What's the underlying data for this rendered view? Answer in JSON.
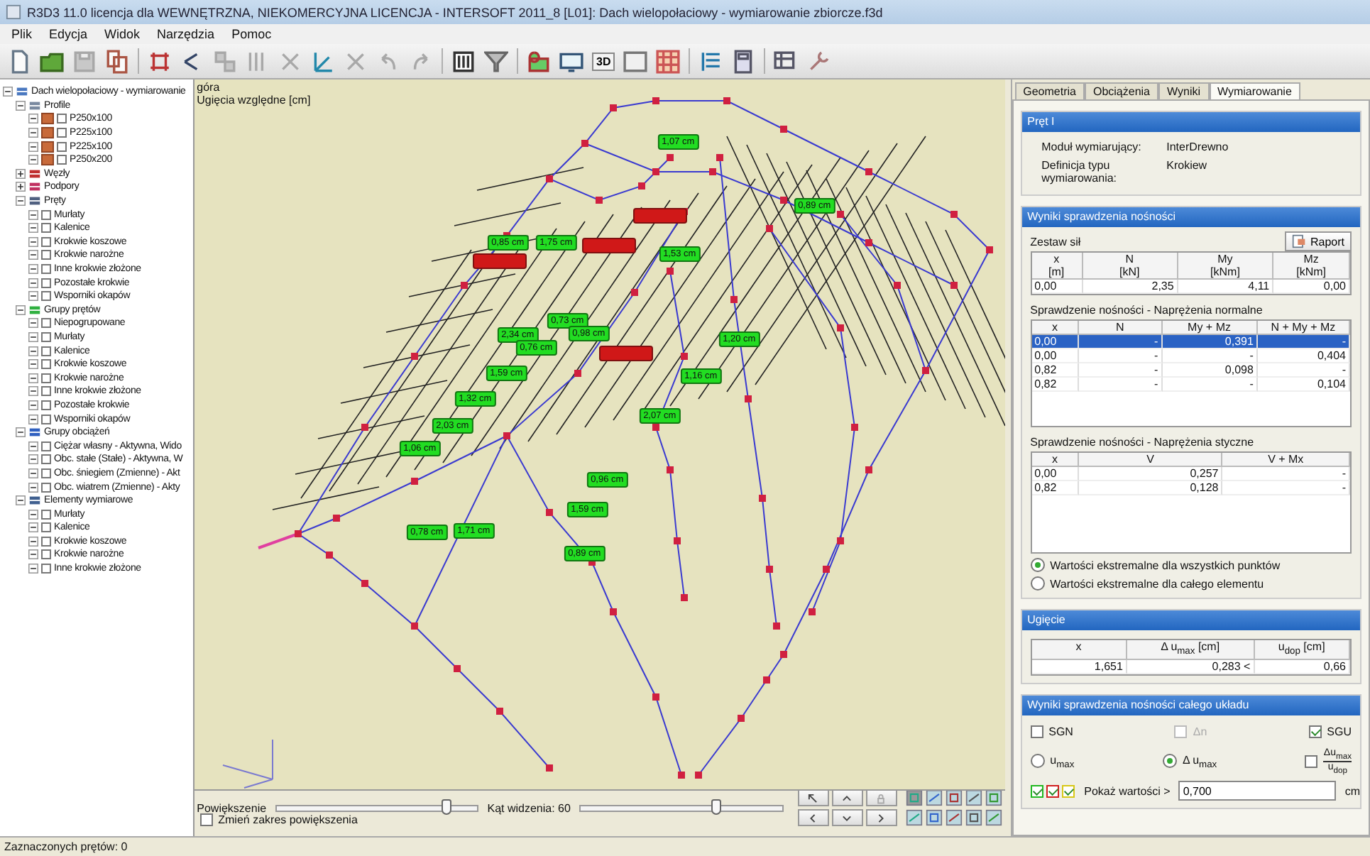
{
  "window": {
    "title": "R3D3 11.0 licencja dla WEWNĘTRZNA, NIEKOMERCYJNA LICENCJA - INTERSOFT 2011_8 [L01]: Dach wielopołaciowy - wymiarowanie zbiorcze.f3d"
  },
  "menu": [
    "Plik",
    "Edycja",
    "Widok",
    "Narzędzia",
    "Pomoc"
  ],
  "toolbar": [
    {
      "disabled": false
    },
    {
      "disabled": false
    },
    {
      "disabled": true
    },
    {
      "disabled": false
    },
    {
      "disabled": false
    },
    {
      "disabled": false
    },
    {
      "disabled": true
    },
    {
      "disabled": true
    },
    {
      "disabled": true
    },
    {
      "disabled": false
    },
    {
      "disabled": true
    },
    {
      "disabled": true
    },
    {
      "disabled": true
    },
    {
      "disabled": false
    },
    {
      "disabled": false
    },
    {
      "disabled": false
    },
    {
      "disabled": false
    },
    {
      "disabled": false,
      "text": "3D"
    },
    {
      "disabled": false
    },
    {
      "disabled": false
    },
    {
      "disabled": false
    },
    {
      "disabled": false
    },
    {
      "disabled": false
    },
    {
      "disabled": false
    }
  ],
  "tree": [
    {
      "label": "Dach wielopołaciowy - wymiarowanie",
      "kind": "group",
      "expanded": true,
      "children": [
        {
          "label": "Profile",
          "kind": "group",
          "expanded": true,
          "children": [
            {
              "label": "P250x100",
              "kind": "profile",
              "checked": false
            },
            {
              "label": "P225x100",
              "kind": "profile",
              "checked": false
            },
            {
              "label": "P225x100",
              "kind": "profile",
              "checked": false
            },
            {
              "label": "P250x200",
              "kind": "profile",
              "checked": false
            }
          ]
        },
        {
          "label": "Węzły",
          "kind": "group",
          "expanded": false
        },
        {
          "label": "Podpory",
          "kind": "group",
          "expanded": false
        },
        {
          "label": "Pręty",
          "kind": "group",
          "expanded": true,
          "children": [
            {
              "label": "Murłaty",
              "kind": "item",
              "checked": false
            },
            {
              "label": "Kalenice",
              "kind": "item",
              "checked": false
            },
            {
              "label": "Krokwie koszowe",
              "kind": "item",
              "checked": false
            },
            {
              "label": "Krokwie narożne",
              "kind": "item",
              "checked": false
            },
            {
              "label": "Inne krokwie złożone",
              "kind": "item",
              "checked": false
            },
            {
              "label": "Pozostałe krokwie",
              "kind": "item",
              "checked": false
            },
            {
              "label": "Wsporniki okapów",
              "kind": "item",
              "checked": false
            }
          ]
        },
        {
          "label": "Grupy prętów",
          "kind": "group",
          "expanded": true,
          "children": [
            {
              "label": "Niepogrupowane",
              "kind": "item",
              "checked": false
            },
            {
              "label": "Murłaty",
              "kind": "item",
              "checked": false
            },
            {
              "label": "Kalenice",
              "kind": "item",
              "checked": false
            },
            {
              "label": "Krokwie koszowe",
              "kind": "item",
              "checked": false
            },
            {
              "label": "Krokwie narożne",
              "kind": "item",
              "checked": false
            },
            {
              "label": "Inne krokwie złożone",
              "kind": "item",
              "checked": false
            },
            {
              "label": "Pozostałe krokwie",
              "kind": "item",
              "checked": false
            },
            {
              "label": "Wsporniki okapów",
              "kind": "item",
              "checked": false
            }
          ]
        },
        {
          "label": "Grupy obciążeń",
          "kind": "group",
          "expanded": true,
          "children": [
            {
              "label": "Ciężar własny - Aktywna, Wido",
              "kind": "item",
              "checked": false
            },
            {
              "label": "Obc. stałe (Stałe) - Aktywna, W",
              "kind": "item",
              "checked": false
            },
            {
              "label": "Obc. śniegiem (Zmienne) - Akt",
              "kind": "item",
              "checked": false
            },
            {
              "label": "Obc. wiatrem (Zmienne) - Akty",
              "kind": "item",
              "checked": false
            }
          ]
        },
        {
          "label": "Elementy wymiarowe",
          "kind": "group",
          "expanded": true,
          "children": [
            {
              "label": "Murłaty",
              "kind": "item",
              "checked": false
            },
            {
              "label": "Kalenice",
              "kind": "item",
              "checked": false
            },
            {
              "label": "Krokwie koszowe",
              "kind": "item",
              "checked": false
            },
            {
              "label": "Krokwie narożne",
              "kind": "item",
              "checked": false
            },
            {
              "label": "Inne krokwie złożone",
              "kind": "item",
              "checked": false
            }
          ]
        }
      ]
    }
  ],
  "canvas": {
    "view": "góra",
    "legend": "Ugięcia względne [cm]",
    "labels": [
      {
        "text": "1,07 cm",
        "exceeded": false
      },
      {
        "text": "0,89 cm",
        "exceeded": false
      },
      {
        "exceeded": true
      },
      {
        "text": "0,85 cm",
        "exceeded": false
      },
      {
        "text": "1,75 cm",
        "exceeded": false
      },
      {
        "exceeded": true
      },
      {
        "exceeded": true
      },
      {
        "text": "1,53 cm",
        "exceeded": false
      },
      {
        "text": "0,73 cm",
        "exceeded": false
      },
      {
        "text": "2,34 cm",
        "exceeded": false
      },
      {
        "text": "0,98 cm",
        "exceeded": false
      },
      {
        "text": "0,76 cm",
        "exceeded": false
      },
      {
        "exceeded": true
      },
      {
        "text": "1,20 cm",
        "exceeded": false
      },
      {
        "text": "1,59 cm",
        "exceeded": false
      },
      {
        "text": "1,16 cm",
        "exceeded": false
      },
      {
        "text": "1,32 cm",
        "exceeded": false
      },
      {
        "text": "2,07 cm",
        "exceeded": false
      },
      {
        "text": "2,03 cm",
        "exceeded": false
      },
      {
        "text": "1,06 cm",
        "exceeded": false
      },
      {
        "text": "0,96 cm",
        "exceeded": false
      },
      {
        "text": "1,59 cm",
        "exceeded": false
      },
      {
        "text": "0,78 cm",
        "exceeded": false
      },
      {
        "text": "1,71 cm",
        "exceeded": false
      },
      {
        "text": "0,89 cm",
        "exceeded": false
      }
    ]
  },
  "view_controls": {
    "zoom": {
      "label": "Powiększenie",
      "level": 0.85
    },
    "angle": {
      "label": "Kąt widzenia: 60",
      "level": 0.68
    },
    "zoom_range": {
      "label": "Zmień zakres powiększenia",
      "checked": false
    }
  },
  "right_panel": {
    "tabs": [
      {
        "label": "Geometria",
        "selected": false
      },
      {
        "label": "Obciążenia",
        "selected": false
      },
      {
        "label": "Wyniki",
        "selected": false
      },
      {
        "label": "Wymiarowanie",
        "selected": true
      }
    ],
    "member": {
      "title": "Pręt I",
      "fields": [
        {
          "label": "Moduł wymiarujący:",
          "value": "InterDrewno"
        },
        {
          "label": "Definicja typu wymiarowania:",
          "value": "Krokiew"
        }
      ]
    },
    "capacity": {
      "title": "Wyniki sprawdzenia nośności",
      "blocks": [
        {
          "label": "Zestaw sił",
          "button": "Raport",
          "table": {
            "columns": [
              "x\n[m]",
              "N\n[kN]",
              "My\n[kNm]",
              "Mz\n[kNm]"
            ],
            "rows": [
              {
                "cells": [
                  "0,00",
                  "2,35",
                  "4,11",
                  "0,00"
                ],
                "selected": false
              }
            ]
          }
        },
        {
          "label": "Sprawdzenie nośności - Naprężenia normalne",
          "table": {
            "columns": [
              "x",
              "N",
              "My + Mz",
              "N + My + Mz"
            ],
            "rows": [
              {
                "cells": [
                  "0,00",
                  "-",
                  "0,391",
                  "-"
                ],
                "selected": true
              },
              {
                "cells": [
                  "0,00",
                  "-",
                  "-",
                  "0,404"
                ],
                "selected": false
              },
              {
                "cells": [
                  "0,82",
                  "-",
                  "0,098",
                  "-"
                ],
                "selected": false
              },
              {
                "cells": [
                  "0,82",
                  "-",
                  "-",
                  "0,104"
                ],
                "selected": false
              }
            ]
          }
        },
        {
          "label": "Sprawdzenie nośności - Naprężenia styczne",
          "table": {
            "columns": [
              "x",
              "V",
              "V + Mx"
            ],
            "rows": [
              {
                "cells": [
                  "0,00",
                  "0,257",
                  "-"
                ],
                "selected": false
              },
              {
                "cells": [
                  "0,82",
                  "0,128",
                  "-"
                ],
                "selected": false
              }
            ]
          }
        }
      ],
      "options": [
        {
          "label": "Wartości ekstremalne dla wszystkich punktów",
          "selected": true
        },
        {
          "label": "Wartości ekstremalne dla całego elementu",
          "selected": false
        }
      ]
    },
    "deflection": {
      "title": "Ugięcie",
      "table": {
        "columns": [
          "x",
          "Δ u$_{max}$ [cm]",
          "u$_{dop}$ [cm]"
        ],
        "rows": [
          {
            "cells": [
              "1,651",
              "0,283 <",
              "0,66"
            ],
            "selected": false
          }
        ]
      }
    },
    "system": {
      "title": "Wyniki sprawdzenia nośności całego układu",
      "checks": [
        {
          "label": "SGN",
          "checked": false,
          "disabled": false
        },
        {
          "label": "Δn",
          "checked": false,
          "disabled": true
        },
        {
          "label": "SGU",
          "checked": true,
          "disabled": false
        }
      ],
      "radios": [
        {
          "label": "u$_{max}$",
          "selected": false
        },
        {
          "label": "Δ u$_{max}$",
          "selected": true
        }
      ],
      "ratio": {
        "numerator": "Δu$_{max}$",
        "denominator": "u$_{dop}$",
        "checked": false
      },
      "color_checks": [
        {
          "color": "#22b822",
          "checked": true
        },
        {
          "color": "#d02020",
          "checked": true
        },
        {
          "color": "#d8c818",
          "checked": true
        }
      ],
      "threshold": {
        "label": "Pokaż wartości >",
        "value": "0,700",
        "unit": "cm"
      }
    }
  },
  "status_bar": "Zaznaczonych prętów: 0"
}
